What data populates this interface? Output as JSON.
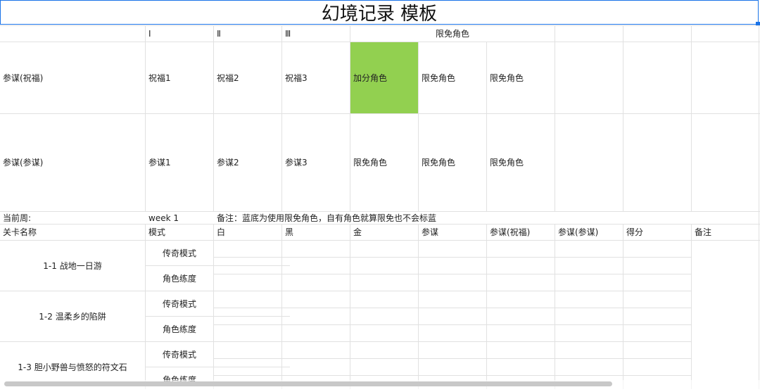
{
  "title": "幻境记录 模板",
  "header_row": [
    "",
    "Ⅰ",
    "Ⅱ",
    "Ⅲ",
    "限免角色"
  ],
  "row_blessing": [
    "参谋(祝福)",
    "祝福1",
    "祝福2",
    "祝福3",
    "加分角色",
    "限免角色",
    "限免角色"
  ],
  "row_strategist": [
    "参谋(参谋)",
    "参谋1",
    "参谋2",
    "参谋3",
    "限免角色",
    "限免角色",
    "限免角色"
  ],
  "week_row": {
    "label": "当前周:",
    "value": "week 1",
    "note": "备注：蓝底为使用限免角色，自有角色就算限免也不会标蓝"
  },
  "columns": [
    "关卡名称",
    "模式",
    "白",
    "黑",
    "金",
    "参谋",
    "参谋(祝福)",
    "参谋(参谋)",
    "得分",
    "备注"
  ],
  "stages": [
    {
      "name": "1-1 战地一日游",
      "modes": [
        "传奇模式",
        "角色练度"
      ]
    },
    {
      "name": "1-2 温柔乡的陷阱",
      "modes": [
        "传奇模式",
        "角色练度"
      ]
    },
    {
      "name": "1-3 胆小野兽与愤怒的符文石",
      "modes": [
        "传奇模式",
        "角色练度"
      ]
    }
  ],
  "colors": {
    "highlight": "#92d050",
    "selection": "#1a73e8",
    "gridline": "#e1e1e1"
  }
}
